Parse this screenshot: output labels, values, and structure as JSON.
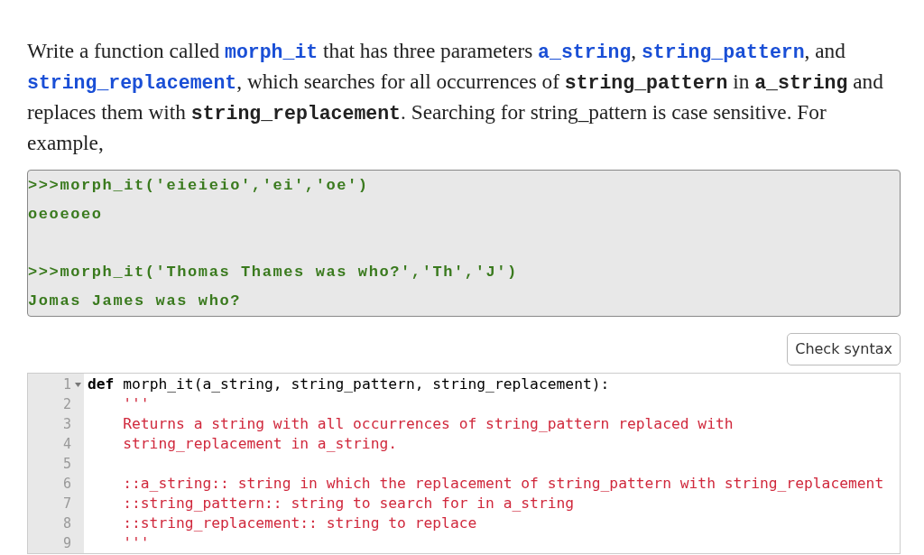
{
  "prompt": [
    {
      "kind": "text",
      "text": "Write a function called "
    },
    {
      "kind": "code_link",
      "text": "morph_it"
    },
    {
      "kind": "text",
      "text": " that has three parameters "
    },
    {
      "kind": "code_link",
      "text": "a_string"
    },
    {
      "kind": "text",
      "text": ", "
    },
    {
      "kind": "code_link",
      "text": "string_pattern"
    },
    {
      "kind": "text",
      "text": ", and "
    },
    {
      "kind": "code_link",
      "text": "string_replacement"
    },
    {
      "kind": "text",
      "text": ", which searches for all occurrences of "
    },
    {
      "kind": "code",
      "text": "string_pattern"
    },
    {
      "kind": "text",
      "text": " in "
    },
    {
      "kind": "code",
      "text": "a_string"
    },
    {
      "kind": "text",
      "text": " and replaces them with "
    },
    {
      "kind": "code",
      "text": "string_replacement"
    },
    {
      "kind": "text",
      "text": ".  Searching for string_pattern is case sensitive.  For example,"
    }
  ],
  "examples": [
    {
      "lines": [
        ">>>morph_it('eieieio','ei','oe')",
        "oeoeoeo"
      ]
    },
    {
      "lines": [
        ">>>morph_it('Thomas Thames was who?','Th','J')",
        "Jomas James was who?"
      ]
    }
  ],
  "check_button": "Check syntax",
  "editor": {
    "lines": [
      {
        "number": "1",
        "foldable": true,
        "segments": [
          {
            "kind": "keyword",
            "text": "def"
          },
          {
            "kind": "plain",
            "text": " morph_it(a_string, string_pattern, string_replacement):"
          }
        ]
      },
      {
        "number": "2",
        "segments": [
          {
            "kind": "string",
            "text": "    '''"
          }
        ]
      },
      {
        "number": "3",
        "segments": [
          {
            "kind": "string",
            "text": "    Returns a string with all occurrences of string_pattern replaced with"
          }
        ]
      },
      {
        "number": "4",
        "segments": [
          {
            "kind": "string",
            "text": "    string_replacement in a_string."
          }
        ]
      },
      {
        "number": "5"
      },
      {
        "number": "6",
        "segments": [
          {
            "kind": "string",
            "text": "    ::a_string:: string in which the replacement of string_pattern with string_replacement"
          }
        ]
      },
      {
        "number": "7",
        "segments": [
          {
            "kind": "string",
            "text": "    ::string_pattern:: string to search for in a_string"
          }
        ]
      },
      {
        "number": "8",
        "segments": [
          {
            "kind": "string",
            "text": "    ::string_replacement:: string to replace"
          }
        ]
      },
      {
        "number": "9",
        "segments": [
          {
            "kind": "string",
            "text": "    '''"
          }
        ]
      }
    ]
  }
}
